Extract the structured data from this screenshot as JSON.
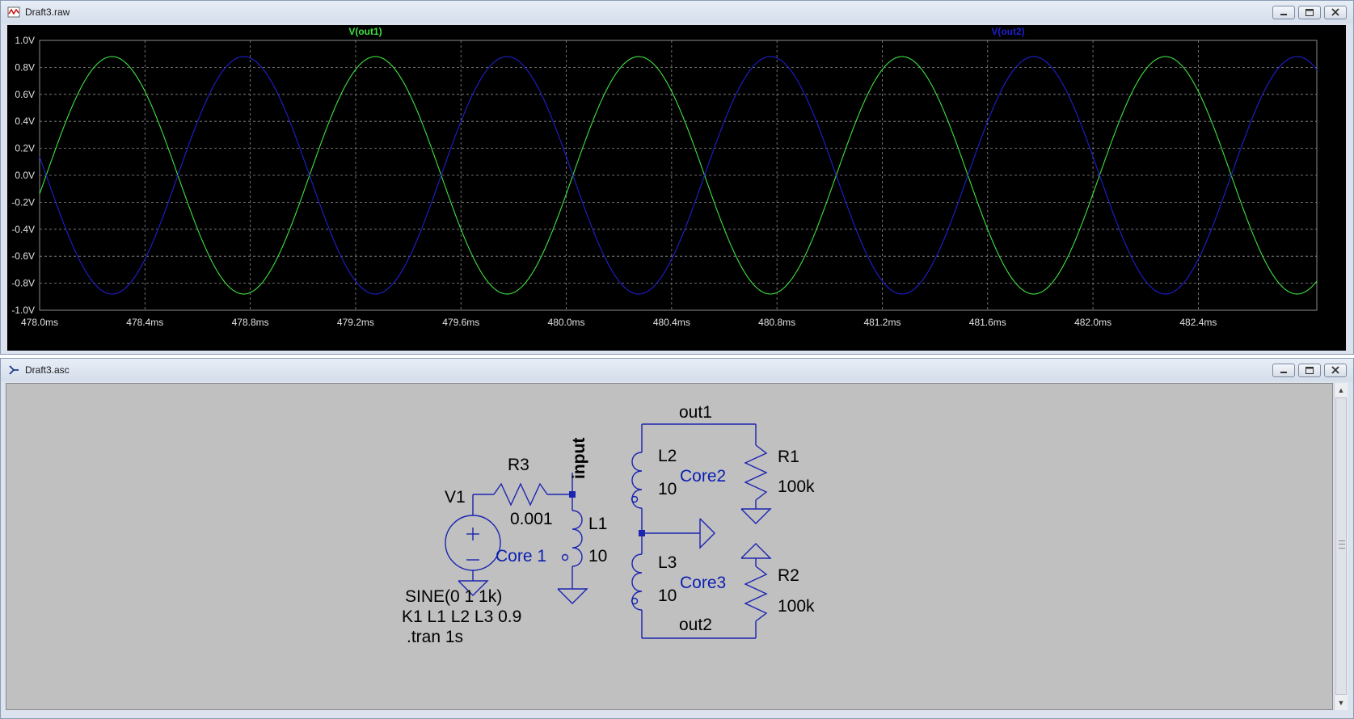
{
  "colors": {
    "plot_bg": "#000000",
    "grid": "#8c8c8c",
    "axis_text": "#e0e0e0",
    "trace_out1": "#3fe23f",
    "trace_out2": "#1f1fd0",
    "schematic_bg": "#c0c0c0",
    "wire": "#1a24b0",
    "component_label": "#000000",
    "core_label": "#0a1fb0"
  },
  "waveform_window": {
    "title": "Draft3.raw",
    "icon": "waveform-icon",
    "buttons": [
      "minimize",
      "restore",
      "close"
    ],
    "chart_data": {
      "type": "line",
      "x_unit": "ms",
      "xlim": [
        478.0,
        482.85
      ],
      "ylim": [
        -1.0,
        1.0
      ],
      "grid": true,
      "xticks": [
        "478.0ms",
        "478.4ms",
        "478.8ms",
        "479.2ms",
        "479.6ms",
        "480.0ms",
        "480.4ms",
        "480.8ms",
        "481.2ms",
        "481.6ms",
        "482.0ms",
        "482.4ms"
      ],
      "yticks": [
        "1.0V",
        "0.8V",
        "0.6V",
        "0.4V",
        "0.2V",
        "0.0V",
        "-0.2V",
        "-0.4V",
        "-0.6V",
        "-0.8V",
        "-1.0V"
      ],
      "series": [
        {
          "name": "V(out1)",
          "color": "#3fe23f",
          "amplitude": 0.88,
          "frequency_khz": 1.0,
          "zero_cross_rising_ms": 478.025
        },
        {
          "name": "V(out2)",
          "color": "#1f1fd0",
          "amplitude": 0.88,
          "frequency_khz": 1.0,
          "zero_cross_rising_ms": 478.525
        }
      ]
    }
  },
  "schematic_window": {
    "title": "Draft3.asc",
    "icon": "schematic-icon",
    "buttons": [
      "minimize",
      "restore",
      "close"
    ],
    "labels": {
      "v1": "V1",
      "r3": "R3",
      "r3_value": "0.001",
      "input": "input",
      "l1": "L1",
      "l1_value": "10",
      "core1": "Core 1",
      "out1": "out1",
      "l2": "L2",
      "l2_value": "10",
      "core2": "Core2",
      "r1": "R1",
      "r1_value": "100k",
      "l3": "L3",
      "l3_value": "10",
      "core3": "Core3",
      "r2": "R2",
      "r2_value": "100k",
      "out2": "out2"
    },
    "directives": [
      "SINE(0 1 1k)",
      "K1 L1 L2 L3 0.9",
      ".tran 1s"
    ]
  }
}
